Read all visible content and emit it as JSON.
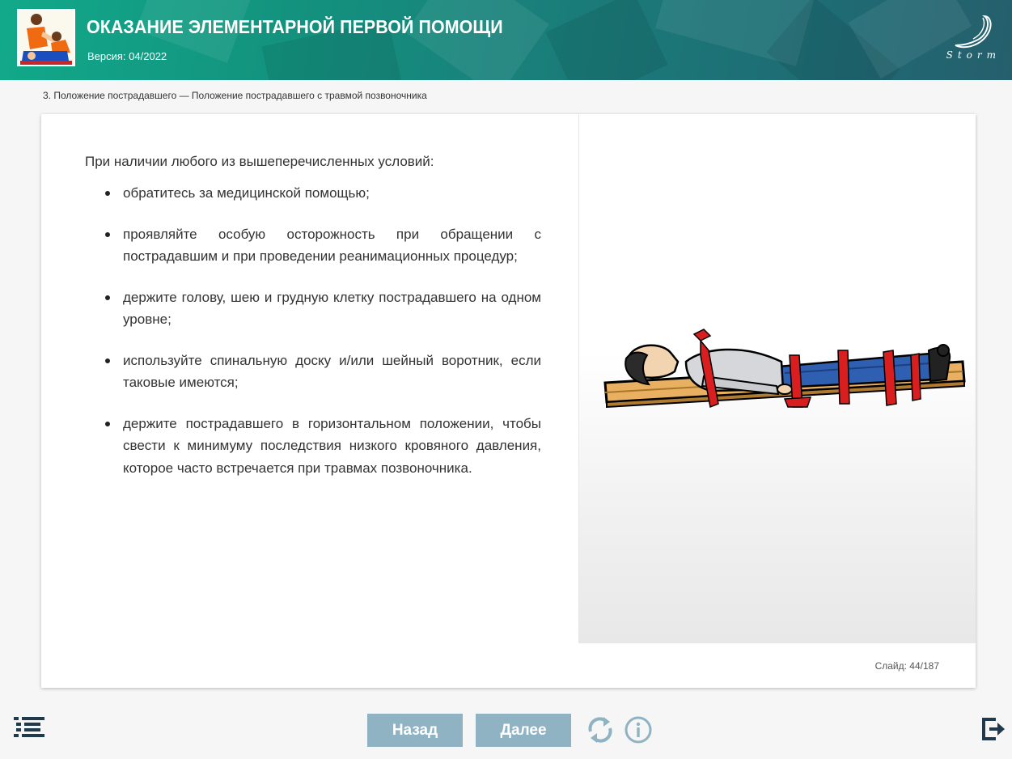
{
  "header": {
    "title": "ОКАЗАНИЕ ЭЛЕМЕНТАРНОЙ ПЕРВОЙ ПОМОЩИ",
    "version": "Версия: 04/2022",
    "logo_text": "Storm",
    "thumbnail_icon": "first-aid-cpr-thumbnail",
    "accent_color": "#13937f"
  },
  "breadcrumb": "3. Положение пострадавшего — Положение пострадавшего с травмой позвоночника",
  "slide": {
    "intro": "При наличии любого из вышеперечисленных условий:",
    "bullets": [
      "обратитесь за медицинской помощью;",
      "проявляйте особую осторожность при обращении с пострадавшим и при проведении реанимационных процедур;",
      "держите голову, шею и грудную клетку пострадавшего на одном уровне;",
      "используйте спинальную доску и/или шейный воротник, если таковые имеются;",
      "держите пострадавшего в горизонтальном положении, чтобы свести к минимуму последствия низкого кровяного давления, которое часто встречается при травмах позвоночника."
    ],
    "illustration": "person-strapped-to-spinal-board",
    "counter_label": "Слайд:",
    "counter_value": "44/187"
  },
  "footer": {
    "back_label": "Назад",
    "next_label": "Далее",
    "menu_icon": "list-menu-icon",
    "reload_icon": "reload-icon",
    "info_icon": "info-icon",
    "exit_icon": "exit-icon",
    "button_color": "#8fb3c3"
  }
}
